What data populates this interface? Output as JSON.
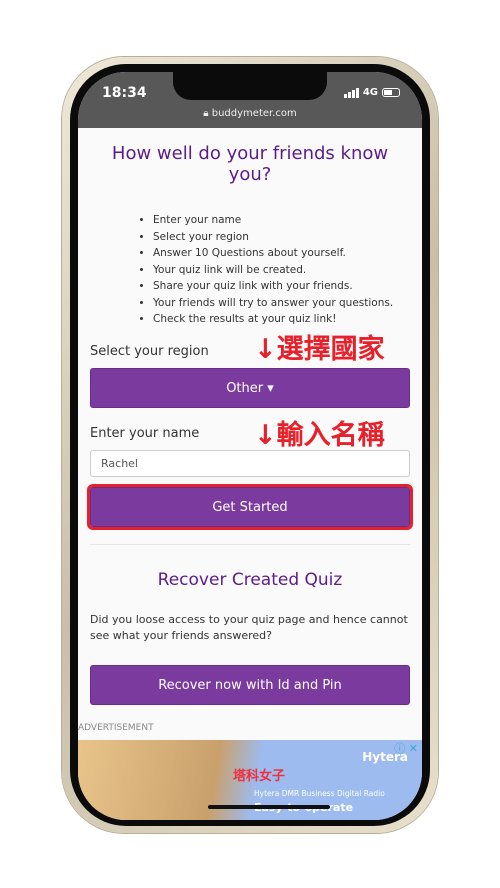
{
  "status": {
    "time": "18:34",
    "network": "4G",
    "battery_level": 0.55
  },
  "browser": {
    "url": "buddymeter.com"
  },
  "page": {
    "title": "How well do your friends know you?",
    "steps": [
      "Enter your name",
      "Select your region",
      "Answer 10 Questions about yourself.",
      "Your quiz link will be created.",
      "Share your quiz link with your friends.",
      "Your friends will try to answer your questions.",
      "Check the results at your quiz link!"
    ],
    "region_label": "Select your region",
    "region_value": "Other ▾",
    "name_label": "Enter your name",
    "name_value": "Rachel",
    "start_button": "Get Started",
    "recover_title": "Recover Created Quiz",
    "recover_text": "Did you loose access to your quiz page and hence cannot see what your friends answered?",
    "recover_button": "Recover now with Id and Pin",
    "ad_label": "ADVERTISEMENT"
  },
  "ad": {
    "brand": "Hytera",
    "subtitle": "Hytera DMR Business Digital Radio",
    "headline": "Easy-to-operate",
    "controls": "ⓘ ✕"
  },
  "annotations": {
    "region": "↓選擇國家",
    "name": "↓輸入名稱",
    "watermark": "塔科女子"
  },
  "colors": {
    "primary": "#7b3a9e",
    "title": "#5c1b8c",
    "highlight": "#e8202a"
  }
}
